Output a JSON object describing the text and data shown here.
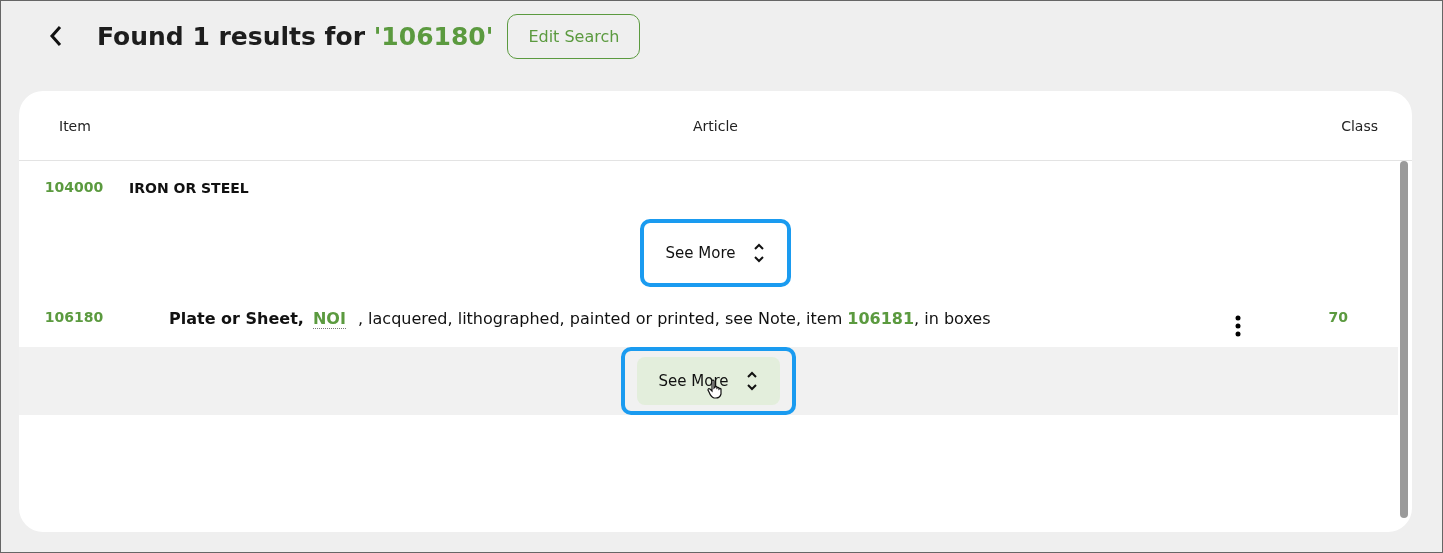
{
  "header": {
    "title": "Found 1 results for ",
    "query": "'106180'",
    "edit_button": "Edit Search"
  },
  "table": {
    "columns": [
      "Item",
      "Article",
      "Class"
    ],
    "rows": [
      {
        "kind": "group",
        "item": "104000",
        "article": [
          {
            "kind": "bold",
            "text": "IRON OR STEEL"
          }
        ],
        "see_more": {
          "label": "See More",
          "hovered": false,
          "highlighted": true
        }
      },
      {
        "kind": "entry",
        "item": "106180",
        "article": [
          {
            "kind": "bold",
            "text": "Plate or Sheet,"
          },
          {
            "kind": "link",
            "text": "NOI"
          },
          {
            "kind": "text",
            "text": ", lacquered, lithographed, painted or printed, see Note, item "
          },
          {
            "kind": "ref",
            "text": "106181"
          },
          {
            "kind": "text",
            "text": ", in boxes"
          }
        ],
        "class": "70",
        "see_more": {
          "label": "See More",
          "hovered": true,
          "highlighted": true
        }
      }
    ]
  }
}
